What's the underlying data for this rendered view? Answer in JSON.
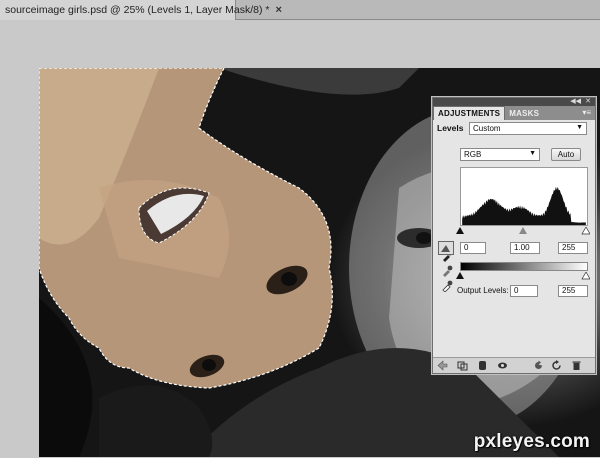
{
  "tab": {
    "title": "sourceimage girls.psd @ 25% (Levels 1, Layer Mask/8) *",
    "close": "×"
  },
  "watermark": "pxleyes.com",
  "panel": {
    "tabs": [
      "ADJUSTMENTS",
      "MASKS"
    ],
    "levels_label": "Levels",
    "preset_value": "Custom",
    "channel_value": "RGB",
    "auto_label": "Auto",
    "input_levels": {
      "black": "0",
      "gamma": "1.00",
      "white": "255"
    },
    "output_label": "Output Levels:",
    "output_levels": {
      "black": "0",
      "white": "255"
    }
  },
  "icons": {
    "eyedroppers": [
      "black-point-eyedropper-icon",
      "gray-point-eyedropper-icon",
      "white-point-eyedropper-icon"
    ],
    "bottom": [
      "back-arrow-icon",
      "clip-to-layer-icon",
      "visibility-eye-icon",
      "view-previous-icon",
      "reset-icon",
      "delete-icon"
    ]
  },
  "colors": {
    "panel_bg": "#e5e5e5",
    "tab_bar": "#8d8d8d",
    "selection": "#ffffff"
  }
}
